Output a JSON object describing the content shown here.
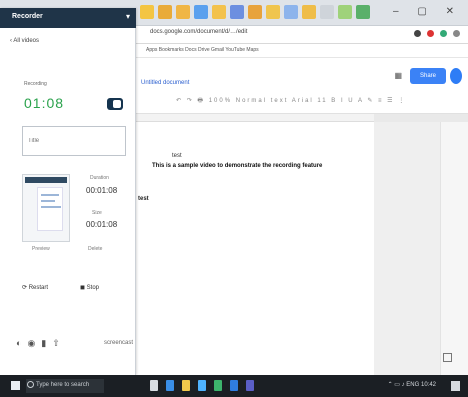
{
  "browser": {
    "url": "docs.google.com/document/d/…/edit",
    "bookmarks": "Apps   Bookmarks   Docs   Drive   Gmail   YouTube   Maps"
  },
  "docs": {
    "title": "Untitled document",
    "share_label": "Share",
    "grid_icon": "apps-grid-icon",
    "toolbar_text": "↶ ↷ 🖶 100% Normal text Arial 11 B I U A ✎ ≡ ☰ ⋮"
  },
  "document": {
    "line1": "test",
    "line2": "This is a sample video to demonstrate the recording feature",
    "line3": "test"
  },
  "panel": {
    "title": "Recorder",
    "back": "‹ All videos",
    "rec_label": "Recording",
    "timer": "01:08",
    "title_placeholder": "Title",
    "stat1_label": "Duration",
    "stat1_value": "00:01:08",
    "stat2_label": "Size",
    "stat2_value": "00:01:08",
    "thumb_caption": "Preview",
    "thumb_caption2": "Delete",
    "opt1": "⟳ Restart",
    "opt2": "◼ Stop",
    "brand": "screencast"
  },
  "taskbar": {
    "search_text": "Type here to search",
    "tray_text": "⌃ ▭ ♪ ENG 10:42"
  },
  "colors": {
    "panel_header": "#1f3448",
    "timer_green": "#2aa24c",
    "share_blue": "#3b82f6"
  }
}
